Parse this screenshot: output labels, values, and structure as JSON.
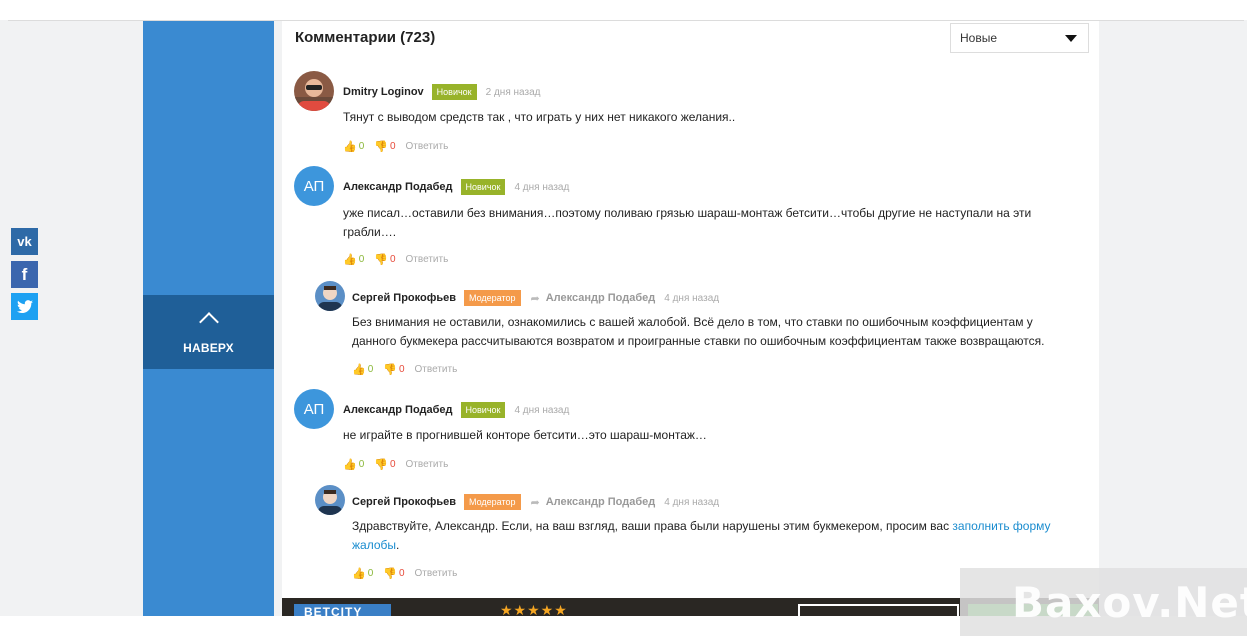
{
  "comments_header": {
    "title": "Комментарии (723)",
    "sort_selected": "Новые"
  },
  "social": {
    "vk": "vk",
    "fb": "f",
    "tw": ""
  },
  "back_to_top": {
    "label": "НАВЕРХ"
  },
  "comments": [
    {
      "author": "Dmitry Loginov",
      "badge": "Новичок",
      "date": "2 дня назад",
      "text": "Тянут с выводом средств так , что играть у них нет никакого желания..",
      "likes": "0",
      "dislikes": "0",
      "reply": "Ответить"
    },
    {
      "author": "Александр Подабед",
      "initials": "АП",
      "badge": "Новичок",
      "date": "4 дня назад",
      "text": "уже писал…оставили без внимания…поэтому поливаю грязью шараш-монтаж бетсити…чтобы другие не наступали на эти грабли….",
      "likes": "0",
      "dislikes": "0",
      "reply": "Ответить"
    },
    {
      "author": "Сергей Прокофьев",
      "badge": "Модератор",
      "reply_to": "Александр Подабед",
      "date": "4 дня назад",
      "text": "Без внимания не оставили, ознакомились с вашей жалобой. Всё дело в том, что ставки по ошибочным коэффициентам у данного букмекера рассчитываются возвратом и проигранные ставки по ошибочным коэффициентам также возвращаются.",
      "likes": "0",
      "dislikes": "0",
      "reply": "Ответить"
    },
    {
      "author": "Александр Подабед",
      "initials": "АП",
      "badge": "Новичок",
      "date": "4 дня назад",
      "text": "не играйте в прогнившей конторе бетсити…это шараш-монтаж…",
      "likes": "0",
      "dislikes": "0",
      "reply": "Ответить"
    },
    {
      "author": "Сергей Прокофьев",
      "badge": "Модератор",
      "reply_to": "Александр Подабед",
      "date": "4 дня назад",
      "text_before": "Здравствуйте, Александр. Если, на ваш взгляд, ваши права были нарушены этим букмекером, просим вас ",
      "link": "заполнить форму жалобы",
      "text_after": ".",
      "likes": "0",
      "dislikes": "0",
      "reply": "Ответить"
    }
  ],
  "banner": {
    "logo": "BETCITY"
  },
  "watermark": "Baxov.Net",
  "colors": {
    "sidebar": "#3a8ad1",
    "back_top": "#1f5f98",
    "novice": "#98b32a",
    "moderator": "#f49a4a",
    "link": "#1a8ccf"
  }
}
